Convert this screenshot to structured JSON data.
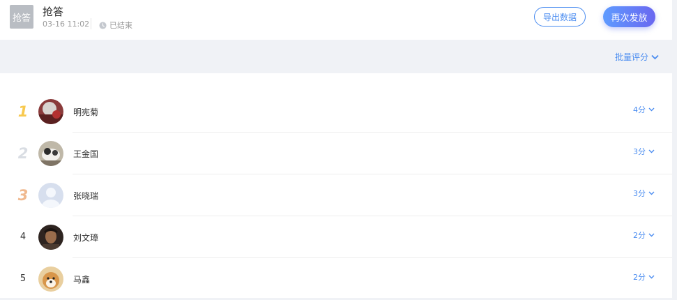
{
  "header": {
    "type_tile": "抢答",
    "title": "抢答",
    "time": "03-16 11:02",
    "status": "已结束",
    "export_label": "导出数据",
    "resend_label": "再次发放"
  },
  "toolbar": {
    "batch_label": "批量评分"
  },
  "colors": {
    "accent": "#4a8cf0",
    "rank1": "#f8c94f",
    "rank2": "#d9dde3",
    "rank3": "#f0b98f"
  },
  "list": [
    {
      "rank": "1",
      "name": "明宪菊",
      "score": "4分"
    },
    {
      "rank": "2",
      "name": "王金国",
      "score": "3分"
    },
    {
      "rank": "3",
      "name": "张晓瑞",
      "score": "3分"
    },
    {
      "rank": "4",
      "name": "刘文璋",
      "score": "2分"
    },
    {
      "rank": "5",
      "name": "马鑫",
      "score": "2分"
    }
  ]
}
